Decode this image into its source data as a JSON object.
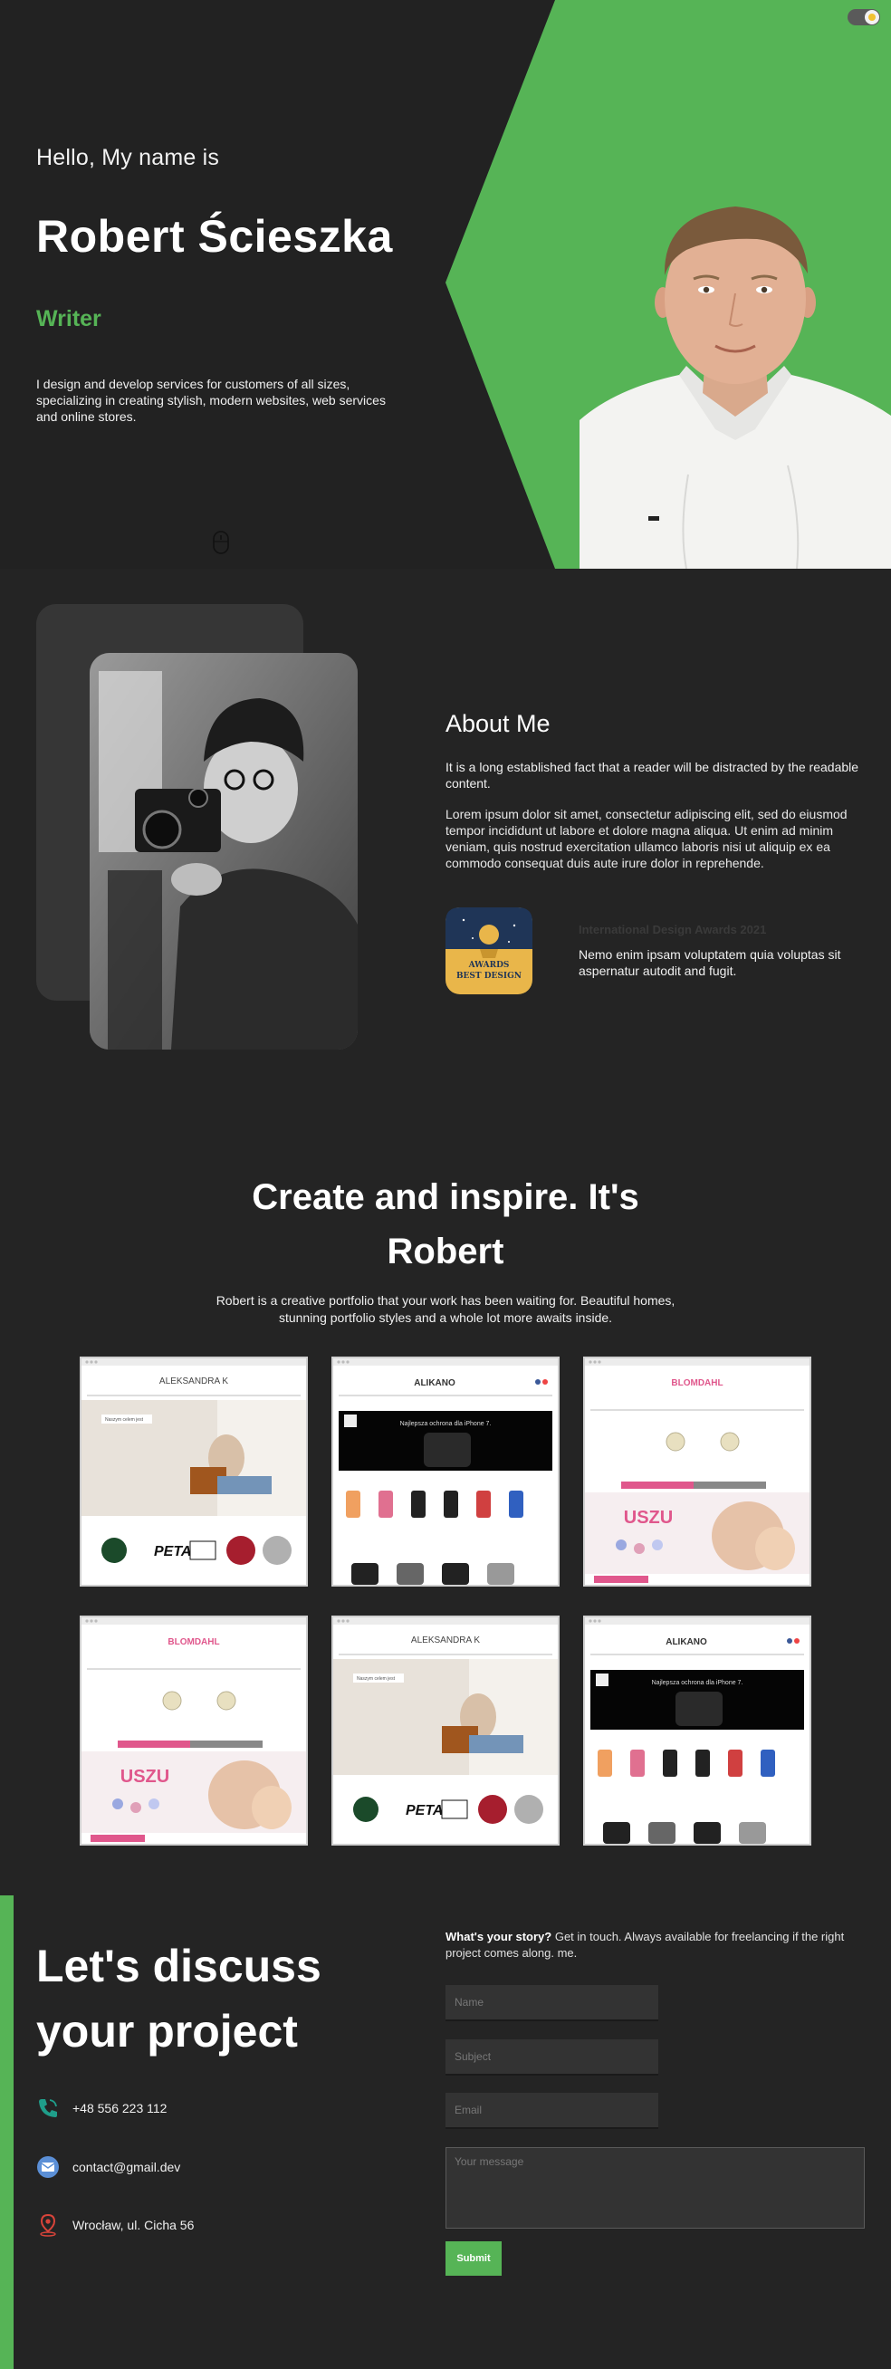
{
  "hero": {
    "greeting": "Hello, My name is",
    "name": "Robert Ścieszka",
    "role": "Writer",
    "intro": "I design and develop services for customers of all sizes, specializing in creating stylish, modern websites, web services and online stores.",
    "scroll_icon": "mouse-icon",
    "accent_color": "#56b456"
  },
  "theme_toggle": {
    "icon": "moon-icon"
  },
  "about": {
    "title": "About Me",
    "paragraph_1": "It is a long established fact that a reader will be distracted by the readable content.",
    "paragraph_2": "Lorem ipsum dolor sit amet, consectetur adipiscing elit, sed do eiusmod tempor incididunt ut labore et dolore magna aliqua. Ut enim ad minim veniam, quis nostrud exercitation ullamco laboris nisi ut aliquip ex ea commodo consequat duis aute irure dolor in reprehende.",
    "award": {
      "badge_line_1": "AWARDS",
      "badge_line_2": "BEST DESIGN",
      "title": "International Design Awards 2021",
      "text": "Nemo enim ipsam voluptatem quia voluptas sit aspernatur autodit and fugit."
    }
  },
  "portfolio": {
    "title_line_1": "Create and inspire. It's",
    "title_line_2": "Robert",
    "description": "Robert is a creative portfolio that your work has been waiting for. Beautiful homes, stunning portfolio styles and a whole lot more awaits inside.",
    "items": [
      {
        "logo": "ALEKSANDRA K",
        "caption": "Naszym celem jest"
      },
      {
        "logo": "ALIKANO",
        "caption": "Najlepsza ochrona dla iPhone 7."
      },
      {
        "logo": "BLOMDAHL",
        "caption": "USZU"
      },
      {
        "logo": "BLOMDAHL",
        "caption": "USZU"
      },
      {
        "logo": "ALEKSANDRA K",
        "caption": "Naszym celem jest"
      },
      {
        "logo": "ALIKANO",
        "caption": "Najlepsza ochrona dla iPhone 7."
      }
    ]
  },
  "contact": {
    "title_line_1": "Let's discuss",
    "title_line_2": "your project",
    "phone": "+48 556 223 112",
    "email": "contact@gmail.dev",
    "address": "Wrocław, ul. Cicha 56",
    "story_bold": "What's your story?",
    "story_text": " Get in touch. Always available for freelancing if the right project comes along. me.",
    "form": {
      "name_placeholder": "Name",
      "subject_placeholder": "Subject",
      "email_placeholder": "Email",
      "message_placeholder": "Your message",
      "submit_label": "Submit"
    }
  }
}
